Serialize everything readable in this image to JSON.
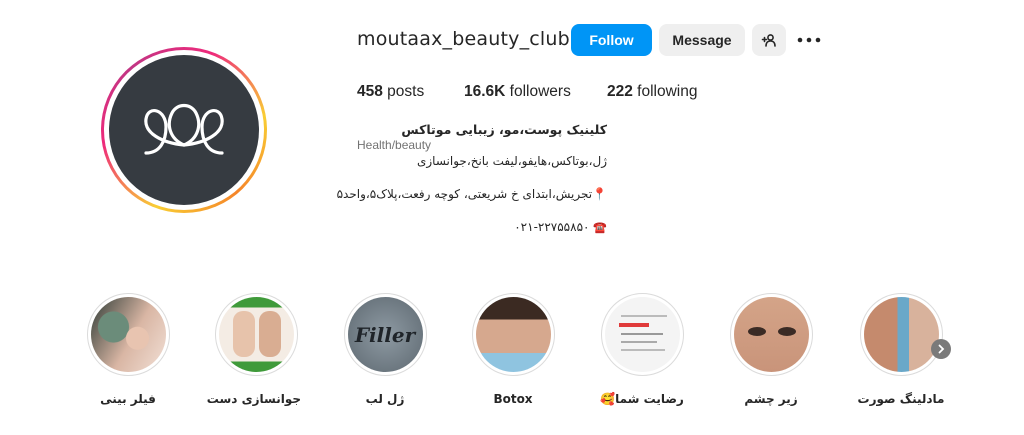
{
  "profile": {
    "username": "moutaax_beauty_club",
    "follow_label": "Follow",
    "message_label": "Message",
    "avatar_icon": "moutaax-logo-icon"
  },
  "stats": {
    "posts_count": "458",
    "posts_label": " posts",
    "followers_count": "16.6K",
    "followers_label": " followers",
    "following_count": "222",
    "following_label": " following"
  },
  "bio": {
    "name": "کلینیک پوست،مو، زیبایی موتاکس",
    "category": "Health/beauty",
    "line1": "ژل،بوتاکس،هایفو،لیفت بانخ،جوانسازی",
    "line2": "تجریش،ابتدای خ شریعتی، کوچه رفعت،پلاک۵،واحد۵",
    "line3": "۰۲۱-۲۲۷۵۵۸۵۰"
  },
  "highlights": [
    {
      "label": "فیلر بینی",
      "icon": "face-photo"
    },
    {
      "label": "جوانسازی دست",
      "icon": "hands-photo"
    },
    {
      "label": "ژل لب",
      "icon": "filler-text-photo",
      "image_text": "Filler"
    },
    {
      "label": "Botox",
      "icon": "face-photo"
    },
    {
      "label": "رضایت شما",
      "emoji": "🥰",
      "icon": "document-photo"
    },
    {
      "label": "زیر چشم",
      "icon": "eyes-photo"
    },
    {
      "label": "مادلینگ صورت",
      "icon": "face-photo"
    }
  ],
  "colors": {
    "follow_button": "#0095f6",
    "secondary_button": "#efefef",
    "avatar_bg": "#363b41"
  }
}
